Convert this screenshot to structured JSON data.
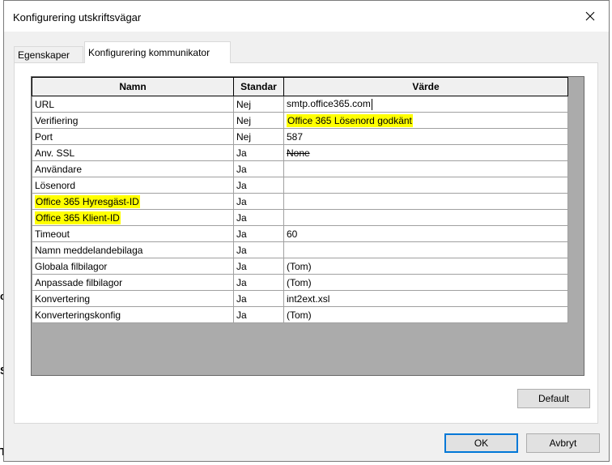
{
  "window": {
    "title": "Konfigurering utskriftsvägar"
  },
  "tabs": [
    {
      "label": "Egenskaper",
      "active": false
    },
    {
      "label": "Konfigurering kommunikator",
      "active": true
    }
  ],
  "grid": {
    "columns": [
      "Namn",
      "Standar",
      "Värde"
    ],
    "rows": [
      {
        "name": "URL",
        "default": "Nej",
        "value": "smtp.office365.com"
      },
      {
        "name": "Verifiering",
        "default": "Nej",
        "value": "Office 365 Lösenord godkänt"
      },
      {
        "name": "Port",
        "default": "Nej",
        "value": "587"
      },
      {
        "name": "Anv. SSL",
        "default": "Ja",
        "value": "None"
      },
      {
        "name": "Användare",
        "default": "Ja",
        "value": ""
      },
      {
        "name": "Lösenord",
        "default": "Ja",
        "value": ""
      },
      {
        "name": "Office 365 Hyresgäst-ID",
        "default": "Ja",
        "value": ""
      },
      {
        "name": "Office 365 Klient-ID",
        "default": "Ja",
        "value": ""
      },
      {
        "name": "Timeout",
        "default": "Ja",
        "value": "60"
      },
      {
        "name": "Namn meddelandebilaga",
        "default": "Ja",
        "value": ""
      },
      {
        "name": "Globala filbilagor",
        "default": "Ja",
        "value": "(Tom)"
      },
      {
        "name": "Anpassade filbilagor",
        "default": "Ja",
        "value": "(Tom)"
      },
      {
        "name": "Konvertering",
        "default": "Ja",
        "value": "int2ext.xsl"
      },
      {
        "name": "Konverteringskonfig",
        "default": "Ja",
        "value": "(Tom)"
      }
    ]
  },
  "buttons": {
    "default_label": "Default",
    "ok_label": "OK",
    "cancel_label": "Avbryt"
  },
  "background_fragments": [
    "c",
    "S",
    "T"
  ],
  "colors": {
    "highlight": "#ffff00",
    "primary_button_border": "#0078d7",
    "dialog_bg": "#f0f0f0"
  }
}
